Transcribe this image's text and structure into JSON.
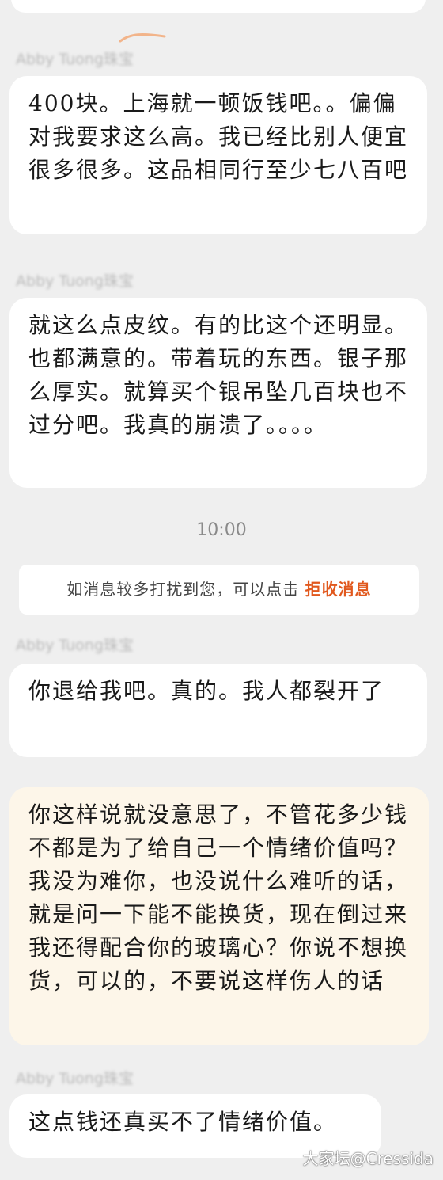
{
  "messages": [
    {
      "sender": "Abby Tuong珠宝",
      "text": "400块。上海就一顿饭钱吧。。偏偏对我要求这么高。我已经比别人便宜很多很多。这品相同行至少七八百吧"
    },
    {
      "sender": "Abby Tuong珠宝",
      "text": "就这么点皮纹。有的比这个还明显。也都满意的。带着玩的东西。银子那么厚实。就算买个银吊坠几百块也不过分吧。我真的崩溃了。。。。"
    },
    {
      "sender": "Abby Tuong珠宝",
      "text": "你退给我吧。真的。我人都裂开了"
    },
    {
      "sender": "",
      "text": "你这样说就没意思了，不管花多少钱不都是为了给自己一个情绪价值吗？我没为难你，也没说什么难听的话，就是问一下能不能换货，现在倒过来我还得配合你的玻璃心？你说不想换货，可以的，不要说这样伤人的话"
    },
    {
      "sender": "Abby Tuong珠宝",
      "text": "这点钱还真买不了情绪价值。"
    }
  ],
  "timestamp": "10:00",
  "notice": {
    "text": "如消息较多打扰到您，可以点击",
    "link": "拒收消息"
  },
  "watermark": "大家坛@Cressida",
  "colors": {
    "background": "#efefef",
    "bubble": "#ffffff",
    "own_bubble": "#fdf6e9",
    "link": "#e1581d"
  }
}
